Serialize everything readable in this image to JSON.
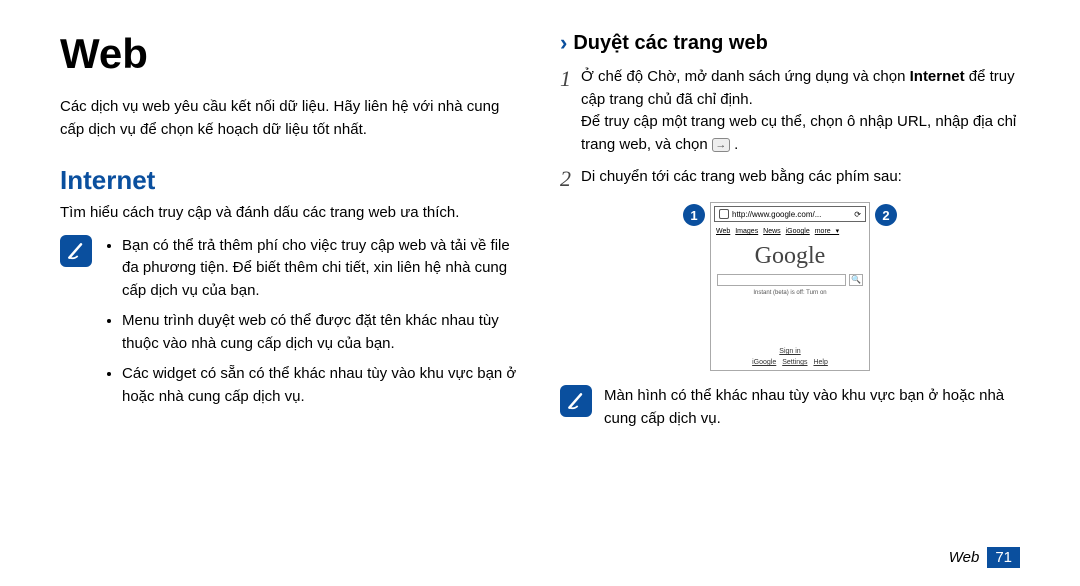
{
  "page": {
    "title": "Web",
    "intro": "Các dịch vụ web yêu cầu kết nối dữ liệu. Hãy liên hệ với nhà cung cấp dịch vụ để chọn kế hoạch dữ liệu tốt nhất.",
    "footer_label": "Web",
    "footer_page": "71"
  },
  "left": {
    "section_title": "Internet",
    "section_desc": "Tìm hiểu cách truy cập và đánh dấu các trang web ưa thích.",
    "notes": [
      "Bạn có thể trả thêm phí cho việc truy cập web và tải về file đa phương tiện. Để biết thêm chi tiết, xin liên hệ nhà cung cấp dịch vụ của bạn.",
      "Menu trình duyệt web có thể được đặt tên khác nhau tùy thuộc vào nhà cung cấp dịch vụ của bạn.",
      "Các widget có sẵn có thể khác nhau tùy vào khu vực bạn ở hoặc nhà cung cấp dịch vụ."
    ]
  },
  "right": {
    "sub_heading": "Duyệt các trang web",
    "step1_a": "Ở chế độ Chờ, mở danh sách ứng dụng và chọn ",
    "step1_bold": "Internet",
    "step1_b": " để truy cập trang chủ đã chỉ định.",
    "step1_c": "Để truy cập một trang web cụ thể, chọn ô nhập URL, nhập địa chỉ trang web, và chọn ",
    "step1_d": " .",
    "step2": "Di chuyển tới các trang web bằng các phím sau:",
    "badge1": "1",
    "badge2": "2",
    "url": "http://www.google.com/...",
    "navlinks": {
      "a": "Web",
      "b": "Images",
      "c": "News",
      "d": "iGoogle",
      "e": "more ▾"
    },
    "logo": "Google",
    "instant": "Instant (beta) is off: Turn on",
    "signin": "Sign in",
    "bottomlinks": {
      "a": "iGoogle",
      "b": "Settings",
      "c": "Help"
    },
    "note_after": "Màn hình có thể khác nhau tùy vào khu vực bạn ở hoặc nhà cung cấp dịch vụ."
  }
}
